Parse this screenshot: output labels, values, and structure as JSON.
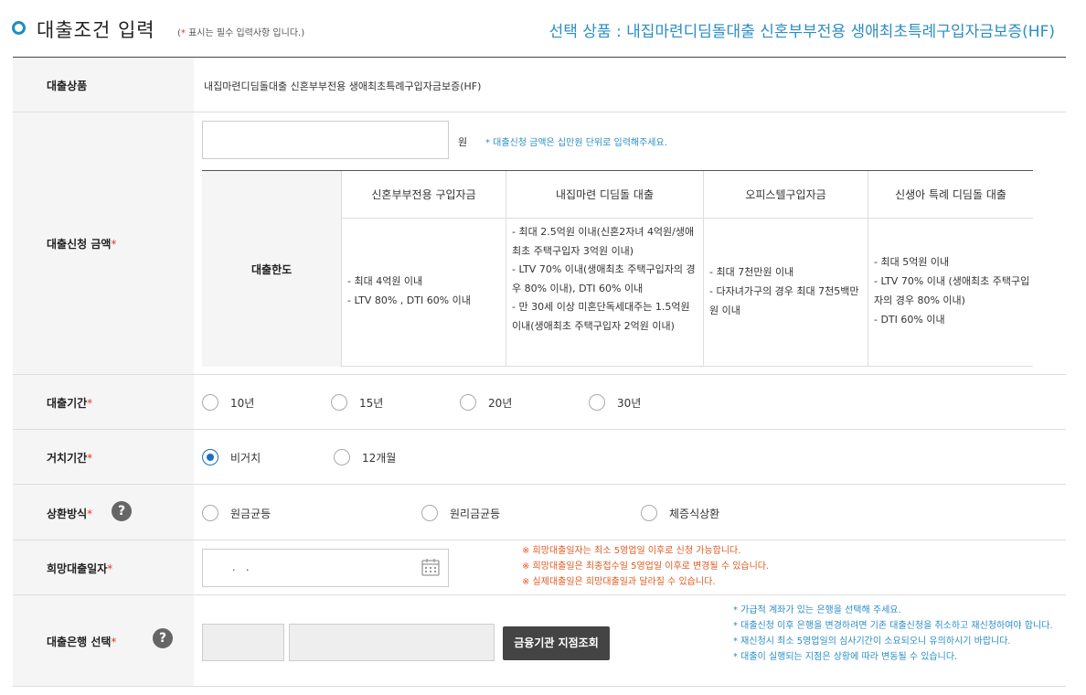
{
  "header": {
    "title": "대출조건 입력",
    "note_star": "*",
    "note_text": " 표시는 필수 입력사항 입니다.",
    "selected_product": "선택 상품 : 내집마련디딤돌대출 신혼부부전용 생애최초특례구입자금보증(HF)"
  },
  "product_row": {
    "label": "대출상품",
    "value": "내집마련디딤돌대출 신혼부부전용 생애최초특례구입자금보증(HF)"
  },
  "amount_row": {
    "label": "대출신청 금액",
    "required": "*",
    "input_value": "",
    "unit": "원",
    "hint": "* 대출신청 금액은 십만원 단위로 입력해주세요.",
    "limit_label": "대출한도",
    "columns": [
      {
        "header": "신혼부부전용 구입자금",
        "content": [
          "- 최대 4억원 이내",
          "- LTV 80% , DTI 60% 이내"
        ]
      },
      {
        "header": "내집마련 디딤돌 대출",
        "content": [
          "- 최대 2.5억원 이내(신혼2자녀 4억원/생애최초 주택구입자 3억원 이내)",
          "- LTV 70% 이내(생애최초 주택구입자의 경우 80% 이내), DTI 60% 이내",
          "- 만 30세 이상 미혼단독세대주는 1.5억원 이내(생애최초 주택구입자 2억원 이내)"
        ]
      },
      {
        "header": "오피스텔구입자금",
        "content": [
          "- 최대 7천만원 이내",
          "- 다자녀가구의 경우 최대 7천5백만원 이내"
        ]
      },
      {
        "header": "신생아 특례 디딤돌 대출",
        "content": [
          "- 최대 5억원 이내",
          "- LTV 70% 이내 (생애최초 주택구입자의 경우 80% 이내)",
          "- DTI 60% 이내"
        ]
      }
    ]
  },
  "period_row": {
    "label": "대출기간",
    "required": "*",
    "options": [
      "10년",
      "15년",
      "20년",
      "30년"
    ],
    "selected": null
  },
  "grace_row": {
    "label": "거치기간",
    "required": "*",
    "options": [
      "비거치",
      "12개월"
    ],
    "selected": "비거치"
  },
  "repay_row": {
    "label": "상환방식",
    "required": "*",
    "help": "?",
    "options": [
      "원금균등",
      "원리금균등",
      "체증식상환"
    ],
    "selected": null
  },
  "date_row": {
    "label": "희망대출일자",
    "required": "*",
    "date_value": ". .",
    "warnings": [
      "※ 희망대출일자는 최소 5영업일 이후로 신청 가능합니다.",
      "※ 희망대출일은 최종접수일 5영업일 이후로 변경될 수 있습니다.",
      "※ 실제대출일은 희망대출일과 달라질 수 있습니다."
    ]
  },
  "bank_row": {
    "label": "대출은행 선택",
    "required": "*",
    "help": "?",
    "bank_value": "",
    "branch_value": "",
    "button": "금융기관 지점조회",
    "notes": [
      "* 가급적 계좌가 있는 은행을 선택해 주세요.",
      "* 대출신청 이후 은행을 변경하려면 기존 대출신청을 취소하고 재신청하여야 합니다.",
      "* 재신청시 최소 5영업일의 심사기간이 소요되오니 유의하시기 바랍니다.",
      "* 대출이 실행되는 지점은 상황에 따라 변동될 수 있습니다."
    ]
  },
  "colors": {
    "accent": "#2b8ec6",
    "required": "#e03b24",
    "warning": "#e05a20",
    "radio_on": "#1a6fc4"
  }
}
